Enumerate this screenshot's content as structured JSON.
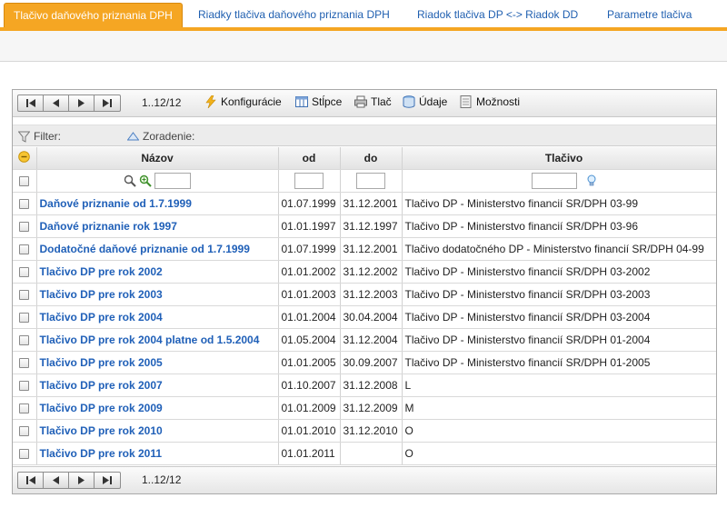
{
  "tabs": [
    {
      "label": "Tlačivo daňového priznania DPH"
    },
    {
      "label": "Riadky tlačiva daňového priznania DPH"
    },
    {
      "label": "Riadok tlačiva DP <-> Riadok DD"
    },
    {
      "label": "Parametre tlačiva"
    }
  ],
  "toolbar": {
    "page_info": "1..12/12",
    "configuration": "Konfigurácie",
    "columns": "Stĺpce",
    "print": "Tlač",
    "data": "Údaje",
    "options": "Možnosti"
  },
  "filterbar": {
    "filter_label": "Filter:",
    "sort_label": "Zoradenie:"
  },
  "columns": {
    "name": "Názov",
    "from": "od",
    "to": "do",
    "form": "Tlačivo"
  },
  "rows": [
    {
      "name": "Daňové priznanie od 1.7.1999",
      "from": "01.07.1999",
      "to": "31.12.2001",
      "form": "Tlačivo DP - Ministerstvo financií SR/DPH 03-99"
    },
    {
      "name": "Daňové priznanie rok 1997",
      "from": "01.01.1997",
      "to": "31.12.1997",
      "form": "Tlačivo DP - Ministerstvo financií SR/DPH 03-96"
    },
    {
      "name": "Dodatočné daňové priznanie od 1.7.1999",
      "from": "01.07.1999",
      "to": "31.12.2001",
      "form": "Tlačivo dodatočného DP - Ministerstvo financií SR/DPH 04-99"
    },
    {
      "name": "Tlačivo DP pre rok 2002",
      "from": "01.01.2002",
      "to": "31.12.2002",
      "form": "Tlačivo DP - Ministerstvo financií SR/DPH 03-2002"
    },
    {
      "name": "Tlačivo DP pre rok 2003",
      "from": "01.01.2003",
      "to": "31.12.2003",
      "form": "Tlačivo DP - Ministerstvo financií SR/DPH 03-2003"
    },
    {
      "name": "Tlačivo DP pre rok 2004",
      "from": "01.01.2004",
      "to": "30.04.2004",
      "form": "Tlačivo DP - Ministerstvo financií SR/DPH 03-2004"
    },
    {
      "name": "Tlačivo DP pre rok 2004 platne od 1.5.2004",
      "from": "01.05.2004",
      "to": "31.12.2004",
      "form": "Tlačivo DP - Ministerstvo financií SR/DPH 01-2004"
    },
    {
      "name": "Tlačivo DP pre rok 2005",
      "from": "01.01.2005",
      "to": "30.09.2007",
      "form": "Tlačivo DP - Ministerstvo financií SR/DPH 01-2005"
    },
    {
      "name": "Tlačivo DP pre rok 2007",
      "from": "01.10.2007",
      "to": "31.12.2008",
      "form": "L"
    },
    {
      "name": "Tlačivo DP pre rok 2009",
      "from": "01.01.2009",
      "to": "31.12.2009",
      "form": "M"
    },
    {
      "name": "Tlačivo DP pre rok 2010",
      "from": "01.01.2010",
      "to": "31.12.2010",
      "form": "O"
    },
    {
      "name": "Tlačivo DP pre rok 2011",
      "from": "01.01.2011",
      "to": "",
      "form": "O"
    }
  ],
  "footer": {
    "page_info": "1..12/12"
  },
  "colors": {
    "accent": "#f5a623",
    "link": "#2060b8"
  }
}
